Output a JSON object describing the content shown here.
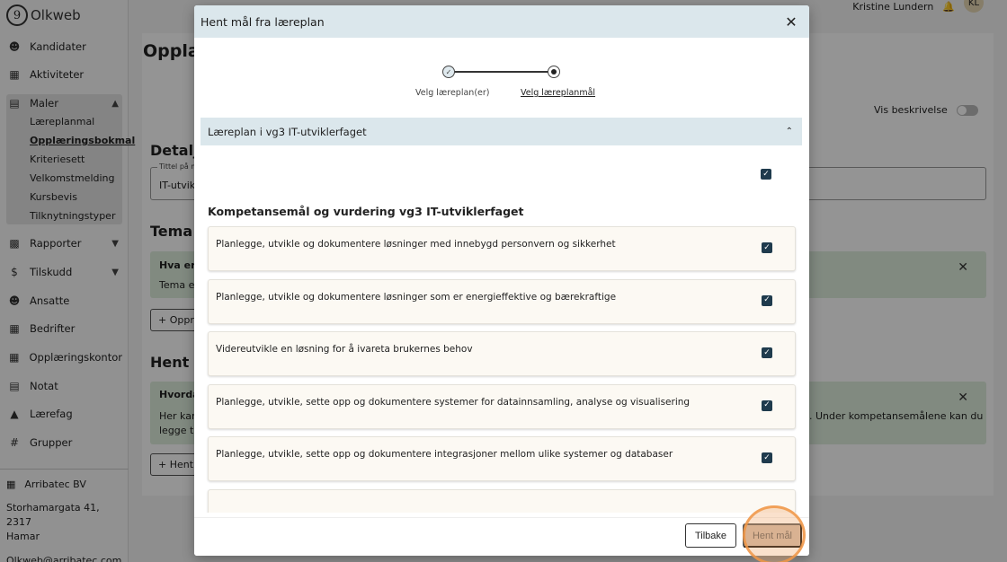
{
  "app": {
    "logo": "Olkweb",
    "user_name": "Kristine Lundern",
    "user_initials": "KL",
    "page_title": "Opplæ",
    "vis_beskrivelse": "Vis beskrivelse"
  },
  "sidebar": {
    "items": [
      {
        "label": "Kandidater",
        "icon": "person-icon"
      },
      {
        "label": "Aktiviteter",
        "icon": "calendar-icon"
      },
      {
        "label": "Maler",
        "icon": "template-icon"
      },
      {
        "label": "Rapporter",
        "icon": "chart-icon"
      },
      {
        "label": "Tilskudd",
        "icon": "dollar-icon"
      },
      {
        "label": "Ansatte",
        "icon": "person-icon"
      },
      {
        "label": "Bedrifter",
        "icon": "building-icon"
      },
      {
        "label": "Opplæringskontor",
        "icon": "office-icon"
      },
      {
        "label": "Notat",
        "icon": "note-icon"
      },
      {
        "label": "Lærefag",
        "icon": "graduation-icon"
      },
      {
        "label": "Grupper",
        "icon": "hash-icon"
      }
    ],
    "maler_sub": [
      "Læreplanmal",
      "Opplæringsbokmal",
      "Kriteriesett",
      "Velkomstmelding",
      "Kursbevis",
      "Tilknytningstyper"
    ],
    "org_name": "Arribatec BV",
    "org_address_1": "Storhamargata 41, 2317",
    "org_address_2": "Hamar",
    "org_email": "Olkweb@arribatec.com"
  },
  "background": {
    "detaljer": "Detalje",
    "input_label": "Tittel på m",
    "input_value": "IT-utvikl",
    "tema": "Tema c",
    "info1_title": "Hva er t",
    "info1_text": "Tema er",
    "btn1": "+ Oppre",
    "hent": "Hent m",
    "info2_title": "Hvordan",
    "info2_text": "Her kan",
    "info2_text2": "legge til",
    "info2_right": ". Under kompetansemålene kan du",
    "btn2": "+ Hent"
  },
  "modal": {
    "title": "Hent mål fra læreplan",
    "steps": [
      "Velg læreplan(er)",
      "Velg læreplanmål"
    ],
    "accordion_title": "Læreplan i vg3 IT-utviklerfaget",
    "section_title": "Kompetansemål og vurdering vg3 IT-utviklerfaget",
    "goals": [
      "Planlegge, utvikle og dokumentere løsninger med innebygd personvern og sikkerhet",
      "Planlegge, utvikle og dokumentere løsninger som er energieffektive og bærekraftige",
      "Videreutvikle en løsning for å ivareta brukernes behov",
      "Planlegge, utvikle, sette opp og dokumentere systemer for datainnsamling, analyse og visualisering",
      "Planlegge, utvikle, sette opp og dokumentere integrasjoner mellom ulike systemer og databaser"
    ],
    "back_label": "Tilbake",
    "fetch_label": "Hent mål"
  }
}
